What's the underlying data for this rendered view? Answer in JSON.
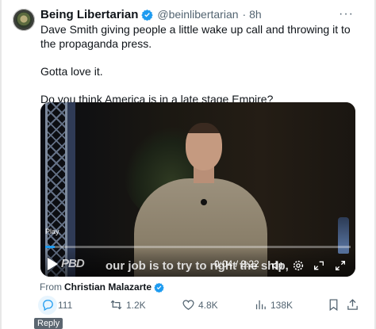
{
  "author": {
    "name": "Being Libertarian",
    "handle": "@beinlibertarian",
    "time": "· 8h"
  },
  "tweet": {
    "line1": "Dave Smith giving people a little wake up call and throwing it to the propaganda press.",
    "line2": "Gotta love it.",
    "line3": "Do you think America is in a late stage Empire?"
  },
  "video": {
    "play_label": "Play",
    "caption": "our job is to try to right the ship,",
    "time": "0:04 / 2:22",
    "watermark": "PBD",
    "progress": 0.03
  },
  "attribution": {
    "prefix": "From",
    "source": "Christian Malazarte"
  },
  "actions": {
    "replies": "111",
    "reposts": "1.2K",
    "likes": "4.8K",
    "views": "138K"
  },
  "tooltip": "Reply",
  "colors": {
    "accent": "#1d9bf0",
    "secondary_text": "#536471"
  },
  "icons": [
    "more-icon",
    "verified-badge-icon",
    "play-icon",
    "volume-icon",
    "settings-icon",
    "pip-icon",
    "fullscreen-icon",
    "reply-icon",
    "repost-icon",
    "like-icon",
    "views-icon",
    "bookmark-icon",
    "share-icon"
  ]
}
